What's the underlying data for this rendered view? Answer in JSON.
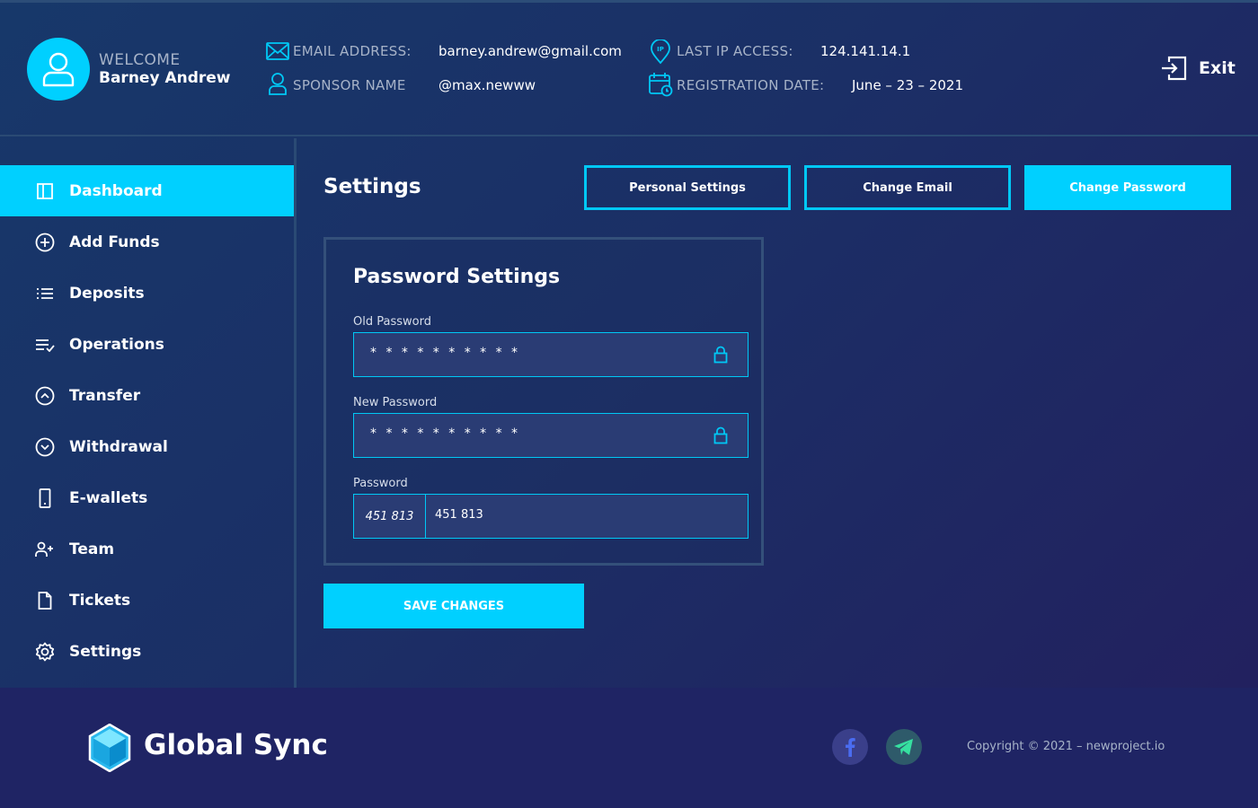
{
  "header": {
    "welcome": "WELCOME",
    "username": "Barney Andrew",
    "email_label": "EMAIL ADDRESS:",
    "email_value": "barney.andrew@gmail.com",
    "sponsor_label": "SPONSOR NAME",
    "sponsor_value": "@max.newww",
    "ip_label": "LAST IP ACCESS:",
    "ip_value": "124.141.14.1",
    "reg_label": "REGISTRATION DATE:",
    "reg_value": "June – 23 – 2021",
    "exit_label": "Exit"
  },
  "sidebar": {
    "items": [
      {
        "label": "Dashboard",
        "icon": "dashboard-icon",
        "active": true
      },
      {
        "label": "Add Funds",
        "icon": "plus-circle-icon"
      },
      {
        "label": "Deposits",
        "icon": "list-icon"
      },
      {
        "label": "Operations",
        "icon": "list-check-icon"
      },
      {
        "label": "Transfer",
        "icon": "chevron-up-circle-icon"
      },
      {
        "label": "Withdrawal",
        "icon": "chevron-down-circle-icon"
      },
      {
        "label": "E-wallets",
        "icon": "phone-icon"
      },
      {
        "label": "Team",
        "icon": "user-plus-icon"
      },
      {
        "label": "Tickets",
        "icon": "document-icon"
      },
      {
        "label": "Settings",
        "icon": "gear-icon"
      }
    ]
  },
  "main": {
    "title": "Settings",
    "tabs": [
      {
        "label": "Personal Settings",
        "active": false
      },
      {
        "label": "Change Email",
        "active": false
      },
      {
        "label": "Change Password",
        "active": true
      }
    ],
    "panel": {
      "title": "Password Settings",
      "old_password_label": "Old Password",
      "old_password_value": "* * * * * * * * * *",
      "new_password_label": "New Password",
      "new_password_value": "* * * * * * * * * *",
      "captcha_label": "Password",
      "captcha_code": "451 813",
      "captcha_input": "451 813"
    },
    "save_label": "SAVE CHANGES"
  },
  "footer": {
    "brand": "Global Sync",
    "copyright": "Copyright © 2021 – newproject.io",
    "social": [
      "facebook-icon",
      "telegram-icon"
    ]
  },
  "colors": {
    "accent": "#00d0ff",
    "background": "#1b2f66",
    "footer": "#1f2464",
    "muted_text": "#a7b3c8"
  }
}
